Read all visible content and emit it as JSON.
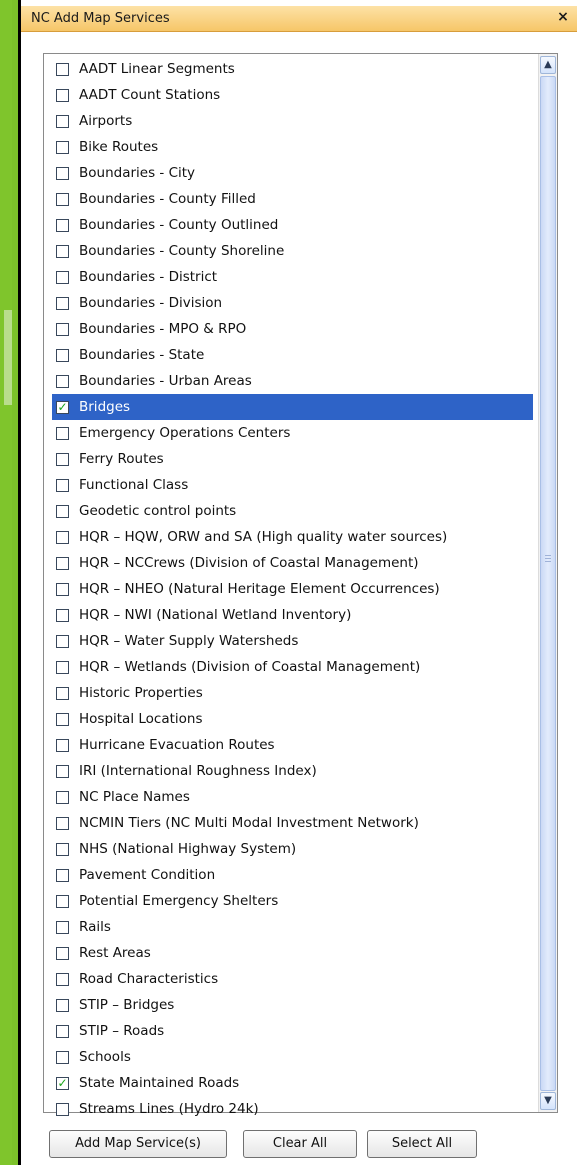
{
  "dialog": {
    "title": "NC Add Map Services",
    "close_glyph": "×"
  },
  "check_glyph": "✓",
  "services": [
    {
      "label": "AADT Linear Segments",
      "checked": false,
      "selected": false
    },
    {
      "label": "AADT Count Stations",
      "checked": false,
      "selected": false
    },
    {
      "label": "Airports",
      "checked": false,
      "selected": false
    },
    {
      "label": "Bike Routes",
      "checked": false,
      "selected": false
    },
    {
      "label": "Boundaries - City",
      "checked": false,
      "selected": false
    },
    {
      "label": "Boundaries - County Filled",
      "checked": false,
      "selected": false
    },
    {
      "label": "Boundaries - County Outlined",
      "checked": false,
      "selected": false
    },
    {
      "label": "Boundaries - County Shoreline",
      "checked": false,
      "selected": false
    },
    {
      "label": "Boundaries - District",
      "checked": false,
      "selected": false
    },
    {
      "label": "Boundaries - Division",
      "checked": false,
      "selected": false
    },
    {
      "label": "Boundaries - MPO & RPO",
      "checked": false,
      "selected": false
    },
    {
      "label": "Boundaries - State",
      "checked": false,
      "selected": false
    },
    {
      "label": "Boundaries - Urban Areas",
      "checked": false,
      "selected": false
    },
    {
      "label": "Bridges",
      "checked": true,
      "selected": true
    },
    {
      "label": "Emergency Operations Centers",
      "checked": false,
      "selected": false
    },
    {
      "label": "Ferry Routes",
      "checked": false,
      "selected": false
    },
    {
      "label": "Functional Class",
      "checked": false,
      "selected": false
    },
    {
      "label": "Geodetic control points",
      "checked": false,
      "selected": false
    },
    {
      "label": "HQR – HQW, ORW and SA (High quality water sources)",
      "checked": false,
      "selected": false
    },
    {
      "label": "HQR – NCCrews (Division of Coastal Management)",
      "checked": false,
      "selected": false
    },
    {
      "label": "HQR – NHEO (Natural Heritage Element Occurrences)",
      "checked": false,
      "selected": false
    },
    {
      "label": "HQR – NWI (National Wetland Inventory)",
      "checked": false,
      "selected": false
    },
    {
      "label": "HQR – Water Supply Watersheds",
      "checked": false,
      "selected": false
    },
    {
      "label": "HQR – Wetlands (Division of Coastal Management)",
      "checked": false,
      "selected": false
    },
    {
      "label": "Historic Properties",
      "checked": false,
      "selected": false
    },
    {
      "label": "Hospital Locations",
      "checked": false,
      "selected": false
    },
    {
      "label": "Hurricane Evacuation Routes",
      "checked": false,
      "selected": false
    },
    {
      "label": "IRI (International Roughness Index)",
      "checked": false,
      "selected": false
    },
    {
      "label": "NC Place Names",
      "checked": false,
      "selected": false
    },
    {
      "label": "NCMIN Tiers (NC Multi Modal Investment Network)",
      "checked": false,
      "selected": false
    },
    {
      "label": "NHS (National Highway System)",
      "checked": false,
      "selected": false
    },
    {
      "label": "Pavement Condition",
      "checked": false,
      "selected": false
    },
    {
      "label": "Potential Emergency Shelters",
      "checked": false,
      "selected": false
    },
    {
      "label": "Rails",
      "checked": false,
      "selected": false
    },
    {
      "label": "Rest Areas",
      "checked": false,
      "selected": false
    },
    {
      "label": "Road Characteristics",
      "checked": false,
      "selected": false
    },
    {
      "label": "STIP – Bridges",
      "checked": false,
      "selected": false
    },
    {
      "label": "STIP – Roads",
      "checked": false,
      "selected": false
    },
    {
      "label": "Schools",
      "checked": false,
      "selected": false
    },
    {
      "label": "State Maintained Roads",
      "checked": true,
      "selected": false
    },
    {
      "label": "Streams Lines (Hydro 24k)",
      "checked": false,
      "selected": false
    }
  ],
  "scrollbar": {
    "up_glyph": "▲",
    "down_glyph": "▼"
  },
  "buttons": {
    "add_label": "Add Map Service(s)",
    "clear_label": "Clear All",
    "select_label": "Select All"
  },
  "colors": {
    "selection": "#2e63c7",
    "check": "#1aa51a",
    "title_bar": "#f6c668",
    "background": "#7cc12a"
  }
}
